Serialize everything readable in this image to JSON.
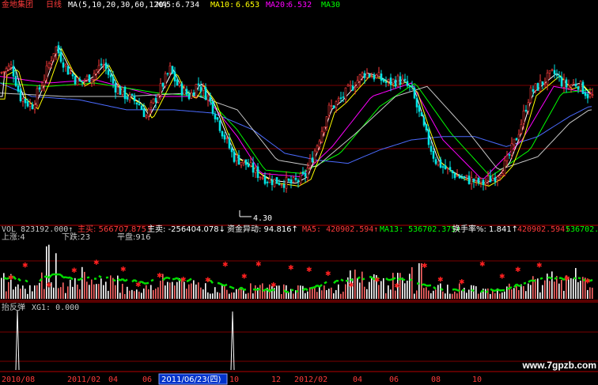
{
  "header": {
    "stock_name": "金地集团",
    "period": "日线",
    "ma_params": "MA(5,10,20,30,60,120)",
    "ma_items": [
      {
        "label": "MA5:",
        "value": "6.734",
        "color": "#ffffff"
      },
      {
        "label": "MA10:",
        "value": "6.653",
        "color": "#ffff00"
      },
      {
        "label": "MA20:",
        "value": "6.532",
        "color": "#ff00ff"
      },
      {
        "label": "MA30",
        "value": "",
        "color": "#00ff00"
      }
    ]
  },
  "price_panel": {
    "low_marker": "4.30"
  },
  "volume_panel": {
    "header_items": [
      {
        "text": "VOL 823192.000↑",
        "color": "#c8c8c8"
      },
      {
        "text": "主买: 566707.875↑",
        "color": "#ff3b3b"
      },
      {
        "text": "主卖: -256404.078↓",
        "color": "#ffffff"
      },
      {
        "text": "资金异动: 94.816↑",
        "color": "#ffffff"
      },
      {
        "text": "MA5: 420902.594↑",
        "color": "#ff3b3b"
      },
      {
        "text": "MA13: 536702.375↑",
        "color": "#00ff00"
      },
      {
        "text": "换手率%: 1.841↑",
        "color": "#ffffff"
      },
      {
        "text": "420902.594↑",
        "color": "#ff3b3b"
      },
      {
        "text": "536702.375↑",
        "color": "#00ff00"
      }
    ],
    "stats": {
      "up": "上涨:4",
      "down": "下跌:23",
      "flat": "平盘:916"
    }
  },
  "indicator_panel": {
    "name": "抬反弹",
    "line": "XG1: 0.000"
  },
  "date_axis": {
    "labels": [
      "2010/08",
      "2011/02",
      "04",
      "06",
      "10",
      "12",
      "2012/02",
      "04",
      "06",
      "08",
      "10"
    ],
    "cursor_date": "2011/06/23(四)"
  },
  "watermark": "www.7gpzb.com",
  "chart_data": {
    "type": "candlestick",
    "series": [
      {
        "name": "MA5",
        "color": "#ffffff"
      },
      {
        "name": "MA10",
        "color": "#ffff00"
      },
      {
        "name": "MA20",
        "color": "#ff00ff"
      },
      {
        "name": "MA30",
        "color": "#00ff00"
      },
      {
        "name": "MA60",
        "color": "#4b6bff"
      },
      {
        "name": "MA120",
        "color": "#c8c8c8"
      }
    ],
    "price_path": [
      [
        0,
        7.6
      ],
      [
        15,
        7.8
      ],
      [
        25,
        6.9
      ],
      [
        40,
        6.6
      ],
      [
        55,
        7.4
      ],
      [
        70,
        8.4
      ],
      [
        85,
        7.7
      ],
      [
        100,
        7.3
      ],
      [
        115,
        7.5
      ],
      [
        130,
        7.9
      ],
      [
        145,
        7.2
      ],
      [
        160,
        6.9
      ],
      [
        175,
        6.7
      ],
      [
        185,
        6.3
      ],
      [
        200,
        7.0
      ],
      [
        215,
        7.7
      ],
      [
        225,
        7.2
      ],
      [
        240,
        6.9
      ],
      [
        250,
        7.3
      ],
      [
        265,
        6.8
      ],
      [
        280,
        5.9
      ],
      [
        295,
        5.1
      ],
      [
        310,
        4.9
      ],
      [
        325,
        4.6
      ],
      [
        340,
        4.4
      ],
      [
        355,
        4.35
      ],
      [
        370,
        4.3
      ],
      [
        385,
        4.5
      ],
      [
        400,
        5.4
      ],
      [
        415,
        6.5
      ],
      [
        430,
        6.8
      ],
      [
        445,
        7.2
      ],
      [
        460,
        7.6
      ],
      [
        475,
        7.5
      ],
      [
        490,
        7.3
      ],
      [
        505,
        7.4
      ],
      [
        520,
        7.1
      ],
      [
        535,
        6.0
      ],
      [
        550,
        5.0
      ],
      [
        565,
        4.7
      ],
      [
        580,
        4.5
      ],
      [
        595,
        4.4
      ],
      [
        610,
        4.3
      ],
      [
        625,
        4.5
      ],
      [
        640,
        4.9
      ],
      [
        655,
        5.8
      ],
      [
        670,
        7.0
      ],
      [
        685,
        7.3
      ],
      [
        700,
        7.6
      ],
      [
        715,
        7.2
      ],
      [
        730,
        7.3
      ],
      [
        745,
        6.9
      ]
    ],
    "ma_paths": {
      "MA20": [
        [
          0,
          7.5
        ],
        [
          60,
          7.3
        ],
        [
          120,
          7.4
        ],
        [
          200,
          6.9
        ],
        [
          260,
          6.9
        ],
        [
          300,
          5.7
        ],
        [
          330,
          4.6
        ],
        [
          380,
          4.5
        ],
        [
          420,
          5.4
        ],
        [
          470,
          6.9
        ],
        [
          520,
          7.3
        ],
        [
          560,
          5.6
        ],
        [
          610,
          4.4
        ],
        [
          660,
          5.6
        ],
        [
          700,
          7.2
        ],
        [
          745,
          7.0
        ]
      ],
      "MA30": [
        [
          0,
          7.3
        ],
        [
          60,
          7.2
        ],
        [
          120,
          7.3
        ],
        [
          200,
          7.0
        ],
        [
          260,
          6.9
        ],
        [
          300,
          5.9
        ],
        [
          335,
          4.7
        ],
        [
          380,
          4.6
        ],
        [
          430,
          5.2
        ],
        [
          480,
          6.6
        ],
        [
          525,
          7.3
        ],
        [
          570,
          5.8
        ],
        [
          620,
          4.5
        ],
        [
          670,
          5.3
        ],
        [
          710,
          7.0
        ],
        [
          745,
          7.1
        ]
      ],
      "MA60": [
        [
          0,
          7.3
        ],
        [
          40,
          6.9
        ],
        [
          100,
          6.8
        ],
        [
          160,
          6.5
        ],
        [
          220,
          6.5
        ],
        [
          270,
          6.4
        ],
        [
          320,
          5.9
        ],
        [
          360,
          5.2
        ],
        [
          400,
          5.0
        ],
        [
          440,
          4.9
        ],
        [
          480,
          5.3
        ],
        [
          520,
          5.6
        ],
        [
          560,
          5.7
        ],
        [
          600,
          5.7
        ],
        [
          640,
          5.4
        ],
        [
          680,
          5.7
        ],
        [
          720,
          6.3
        ],
        [
          745,
          6.6
        ]
      ],
      "MA120": [
        [
          0,
          7.0
        ],
        [
          80,
          6.9
        ],
        [
          160,
          6.9
        ],
        [
          240,
          7.0
        ],
        [
          300,
          6.5
        ],
        [
          350,
          5.0
        ],
        [
          400,
          4.8
        ],
        [
          450,
          5.8
        ],
        [
          500,
          6.9
        ],
        [
          540,
          7.2
        ],
        [
          590,
          5.9
        ],
        [
          630,
          4.7
        ],
        [
          680,
          5.1
        ],
        [
          720,
          6.1
        ],
        [
          745,
          6.5
        ]
      ]
    },
    "indicator_spikes_at": [
      "2011/02",
      "2011/06/23"
    ],
    "ylim": [
      4.3,
      8.6
    ]
  }
}
